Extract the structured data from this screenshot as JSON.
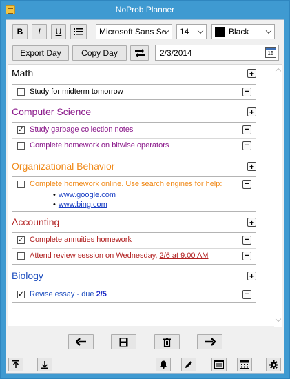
{
  "window": {
    "title": "NoProb Planner"
  },
  "toolbar": {
    "bold_label": "B",
    "italic_label": "I",
    "underline_label": "U",
    "font_name": "Microsoft Sans Se",
    "font_size": "14",
    "color_name": "Black",
    "color_hex": "#000000",
    "export_label": "Export Day",
    "copy_label": "Copy Day",
    "date_value": "2/3/2014",
    "calendar_day": "15"
  },
  "categories": [
    {
      "name": "Math",
      "color": "#000000",
      "tasks": [
        {
          "checked": false,
          "text": "Study for midterm tomorrow"
        }
      ]
    },
    {
      "name": "Computer Science",
      "color": "#8b1a8b",
      "tasks": [
        {
          "checked": true,
          "text": "Study garbage collection notes"
        },
        {
          "checked": false,
          "text": "Complete homework on bitwise operators"
        }
      ]
    },
    {
      "name": "Organizational Behavior",
      "color": "#f08a1a",
      "tasks": [
        {
          "checked": false,
          "text": "Complete homework online. Use search engines for help:",
          "links": [
            "www.google.com",
            "www.bing.com"
          ]
        }
      ]
    },
    {
      "name": "Accounting",
      "color": "#b22222",
      "tasks": [
        {
          "checked": true,
          "text": "Complete annuities homework"
        },
        {
          "checked": false,
          "text_prefix": "Attend review session on Wednesday, ",
          "text_underlined": "2/6 at 9:00 AM"
        }
      ]
    },
    {
      "name": "Biology",
      "color": "#1f4fbf",
      "tasks": [
        {
          "checked": true,
          "text_prefix": "Revise essay - due ",
          "text_bold": "2/5"
        }
      ]
    }
  ],
  "check_mark": "✓",
  "add_symbol": "+",
  "remove_symbol": "−"
}
